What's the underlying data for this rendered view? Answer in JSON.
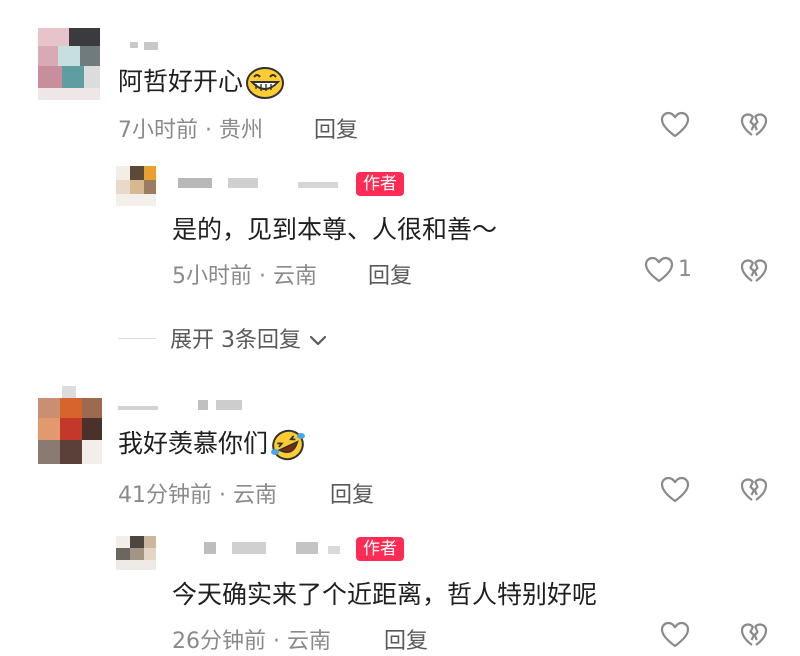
{
  "comments": [
    {
      "content": "阿哲好开心",
      "emoji": "grinning-face-emoji",
      "time": "7小时前 · 贵州",
      "reply_label": "回复",
      "reply": {
        "author_tag": "作者",
        "content": "是的，见到本尊、人很和善～",
        "time": "5小时前 · 云南",
        "reply_label": "回复",
        "likes": "1"
      },
      "expand_label": "展开 3条回复"
    },
    {
      "content": "我好羡慕你们",
      "emoji": "rolling-laughing-emoji",
      "time": "41分钟前 · 云南",
      "reply_label": "回复",
      "reply": {
        "author_tag": "作者",
        "content": "今天确实来了个近距离，哲人特别好呢",
        "time": "26分钟前 · 云南",
        "reply_label": "回复"
      }
    }
  ],
  "icons": {
    "like": "heart-outline-icon",
    "dislike": "broken-heart-icon",
    "expand": "chevron-down-icon"
  },
  "colors": {
    "author_tag": "#fe2c55",
    "meta_text": "#8a8a8a"
  }
}
